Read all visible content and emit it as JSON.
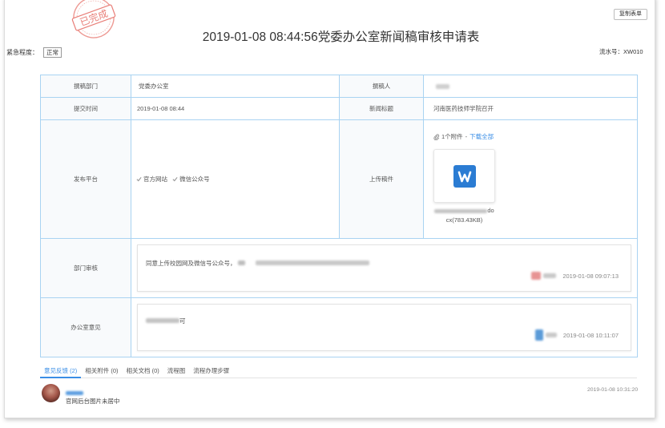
{
  "header": {
    "copy_button": "复制表单",
    "stamp": "已完成",
    "title": "2019-01-08 08:44:56党委办公室新闻稿审核申请表",
    "urgency_label": "紧急程度：",
    "urgency_value": "正常",
    "serial_label": "流水号：",
    "serial_value": "XW010"
  },
  "form": {
    "dept_label": "撰稿部门",
    "dept_value": "党委办公室",
    "author_label": "撰稿人",
    "submit_time_label": "提交时间",
    "submit_time_value": "2019-01-08 08:44",
    "news_title_label": "新闻标题",
    "news_title_value": "河南医药技师学院召开",
    "platform_label": "发布平台",
    "platforms": [
      "官方网站",
      "微信公众号"
    ],
    "upload_label": "上传稿件",
    "attachment": {
      "count_text": "1个附件",
      "separator": "-",
      "download_all": "下载全部",
      "file_icon": "word-icon",
      "name_tail": "do",
      "name_rest": "cx(783.43KB)"
    },
    "dept_review_label": "部门审核",
    "dept_review": {
      "text": "同意上传校园网及微信号公众号，",
      "time": "2019-01-08 09:07:13"
    },
    "office_label": "办公室意见",
    "office_opinion": {
      "text_tail": "可",
      "time": "2019-01-08 10:11:07"
    }
  },
  "tabs": [
    {
      "label": "意见反馈 (2)",
      "active": true
    },
    {
      "label": "相关附件 (0)",
      "active": false
    },
    {
      "label": "相关文档 (0)",
      "active": false
    },
    {
      "label": "流程图",
      "active": false
    },
    {
      "label": "流程办理步骤",
      "active": false
    }
  ],
  "comments": [
    {
      "text": "官网后台图片未居中",
      "time": "2019-01-08 10:31:20"
    }
  ],
  "colors": {
    "accent": "#3a8ee6",
    "table_border": "#a9d3f2",
    "stamp": "#e2544b",
    "word_icon": "#2b7cd3"
  }
}
